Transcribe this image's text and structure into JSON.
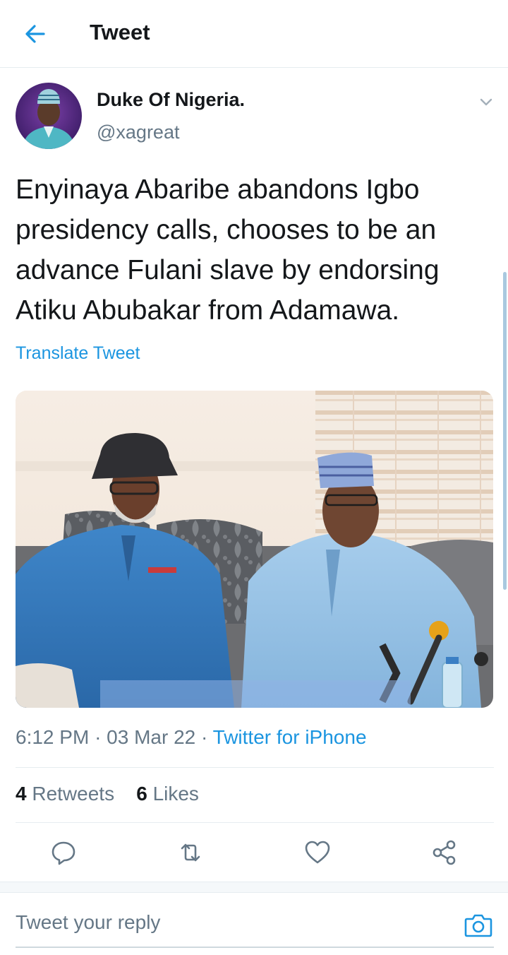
{
  "header": {
    "title": "Tweet",
    "back_icon": "arrow-left-icon"
  },
  "tweet": {
    "author_name": "Duke Of Nigeria.",
    "author_handle": "@xagreat",
    "text": "Enyinaya Abaribe abandons Igbo presidency calls, chooses to be an advance Fulani slave by endorsing Atiku Abubakar from Adamawa.",
    "translate_label": "Translate Tweet",
    "time": "6:12 PM",
    "date": "03 Mar 22",
    "separator": "·",
    "source": "Twitter for iPhone",
    "retweets_count": "4",
    "retweets_label": "Retweets",
    "likes_count": "6",
    "likes_label": "Likes"
  },
  "actions": [
    "reply-icon",
    "retweet-icon",
    "like-icon",
    "share-icon"
  ],
  "reply": {
    "placeholder": "Tweet your reply",
    "camera_icon": "camera-icon"
  },
  "colors": {
    "accent": "#1b95e0",
    "text": "#14171a",
    "secondary": "#657786",
    "divider": "#e6ecf0"
  }
}
